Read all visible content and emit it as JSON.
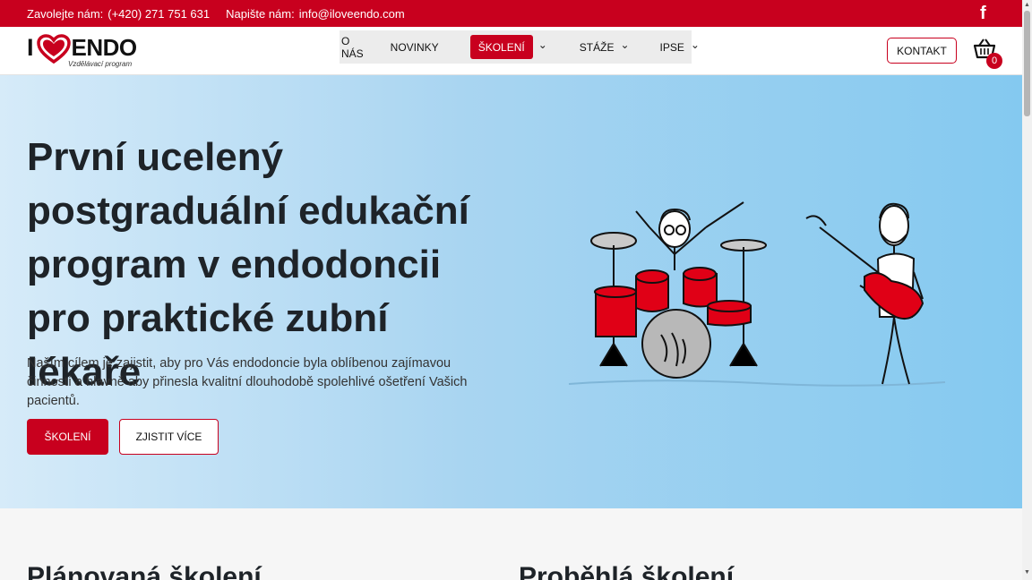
{
  "topbar": {
    "call_label": "Zavolejte nám:",
    "phone": "(+420) 271 751 631",
    "write_label": "Napište nám:",
    "email": "info@iloveendo.com",
    "facebook_glyph": "f"
  },
  "logo": {
    "i": "I",
    "endo": "ENDO",
    "subtitle": "Vzdělávací program"
  },
  "nav": {
    "items": [
      {
        "label": "O NÁS"
      },
      {
        "label": "NOVINKY"
      },
      {
        "label": "ŠKOLENÍ"
      },
      {
        "label": "STÁŽE"
      },
      {
        "label": "IPSE"
      }
    ],
    "chevron": "⌄"
  },
  "header": {
    "kontakt": "KONTAKT",
    "cart_count": "0"
  },
  "hero": {
    "title": "První ucelený postgraduální edukační program v endodoncii pro praktické zubní lékaře",
    "text": "Naším cílem je zajistit, aby pro Vás endodoncie byla oblíbenou zajímavou činností a hlavně aby přinesla kvalitní dlouhodobě spolehlivé ošetření Vašich pacientů.",
    "primary_button": "ŠKOLENÍ",
    "secondary_button": "ZJISTIT VÍCE"
  },
  "sections": {
    "planned": "Plánovaná školení",
    "past": "Proběhlá školení"
  },
  "colors": {
    "brand_red": "#c8001e",
    "hero_blue": "#84c9f0"
  },
  "icons": [
    "facebook-icon",
    "heart-logo-icon",
    "chevron-down-icon",
    "cart-icon"
  ]
}
